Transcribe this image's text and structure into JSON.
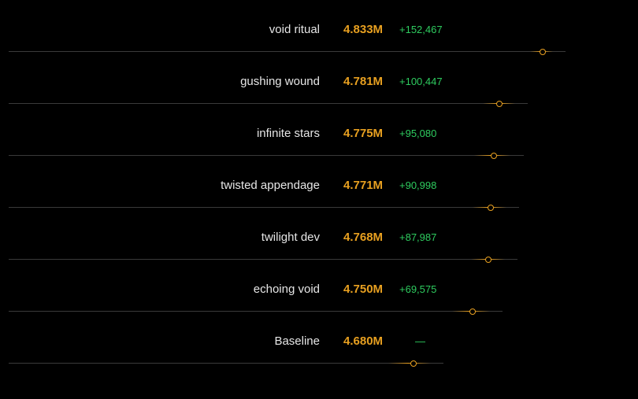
{
  "chart_data": {
    "type": "scatter",
    "title": "",
    "xlabel": "",
    "ylabel": "",
    "xlim": [
      4.2,
      4.9
    ],
    "colors": {
      "value": "#e8a020",
      "delta": "#2ecc5f",
      "label": "#e6e6e6",
      "axis": "#3a3a3a",
      "whisker": "#e8a020"
    },
    "rows": [
      {
        "label": "void ritual",
        "value_text": "4.833M",
        "delta_text": "+152,467",
        "value": 4.833,
        "low": 4.818,
        "high": 4.845
      },
      {
        "label": "gushing wound",
        "value_text": "4.781M",
        "delta_text": "+100,447",
        "value": 4.781,
        "low": 4.762,
        "high": 4.8
      },
      {
        "label": "infinite stars",
        "value_text": "4.775M",
        "delta_text": "+95,080",
        "value": 4.775,
        "low": 4.752,
        "high": 4.795
      },
      {
        "label": "twisted appendage",
        "value_text": "4.771M",
        "delta_text": "+90,998",
        "value": 4.771,
        "low": 4.75,
        "high": 4.79
      },
      {
        "label": "twilight dev",
        "value_text": "4.768M",
        "delta_text": "+87,987",
        "value": 4.768,
        "low": 4.748,
        "high": 4.788
      },
      {
        "label": "echoing void",
        "value_text": "4.750M",
        "delta_text": "+69,575",
        "value": 4.75,
        "low": 4.725,
        "high": 4.77
      },
      {
        "label": "Baseline",
        "value_text": "4.680M",
        "delta_text": "—",
        "value": 4.68,
        "low": 4.65,
        "high": 4.7
      }
    ]
  }
}
